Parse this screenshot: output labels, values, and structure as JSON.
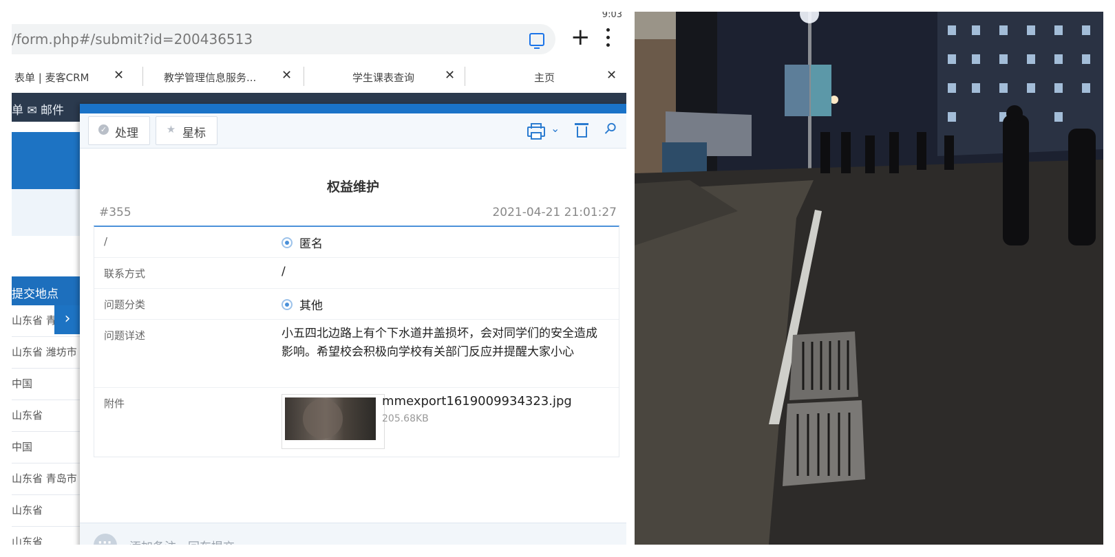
{
  "status": {
    "time": "9:03"
  },
  "browser": {
    "url": "/form.php#/submit?id=200436513",
    "tabs": [
      {
        "label": "表单 | 麦客CRM",
        "close": "✕"
      },
      {
        "label": "教学管理信息服务...",
        "close": "✕"
      },
      {
        "label": "学生课表查询",
        "close": "✕"
      },
      {
        "label": "主页",
        "close": "✕"
      }
    ]
  },
  "crm": {
    "nav_text": "单 ✉ 邮件",
    "sidebar_header": "提交地点",
    "sidebar_rows": [
      "山东省 青",
      "山东省 潍坊市",
      "中国",
      "山东省",
      "中国",
      "山东省 青岛市",
      "山东省",
      "山东省"
    ],
    "expand_arrow": "›"
  },
  "modal": {
    "toolbar": {
      "process_label": "处理",
      "star_label": "星标",
      "chevron": "⌄",
      "pin": "⚲"
    },
    "title": "权益维护",
    "record_id": "#355",
    "record_time": "2021-04-21 21:01:27",
    "fields": [
      {
        "label": "/",
        "value": "匿名"
      },
      {
        "label": "联系方式",
        "value": "/"
      },
      {
        "label": "问题分类",
        "value": "其他"
      },
      {
        "label": "问题详述",
        "value": "小五四北边路上有个下水道井盖损坏，会对同学们的安全造成影响。希望校会积极向学校有关部门反应并提醒大家小心"
      },
      {
        "label": "附件"
      }
    ],
    "attachment": {
      "name": "mmexport1619009934323.jpg",
      "size": "205.68KB"
    },
    "comment_placeholder": "添加备注，回车提交"
  }
}
